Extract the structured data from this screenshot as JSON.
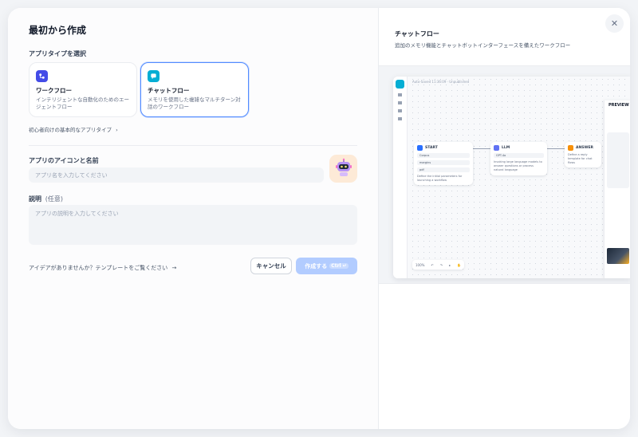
{
  "dialog": {
    "title": "最初から作成"
  },
  "app_type": {
    "label": "アプリタイプを選択",
    "options": [
      {
        "name": "ワークフロー",
        "desc": "インテリジェントな自動化のためのエージェントフロー",
        "selected": false,
        "color": "#444ce7",
        "icon": "workflow-icon"
      },
      {
        "name": "チャットフロー",
        "desc": "メモリを使用した複雑なマルチターン対話のワークフロー",
        "selected": true,
        "color": "#06aed4",
        "icon": "chatflow-icon"
      }
    ],
    "basic_link": "初心者向けの基本的なアプリタイプ"
  },
  "icon_name": {
    "label": "アプリのアイコンと名前",
    "placeholder": "アプリ名を入力してください",
    "avatar_icon": "robot-icon",
    "avatar_bg": "#fdead7"
  },
  "description": {
    "label": "説明",
    "optional": "(任意)",
    "placeholder": "アプリの説明を入力してください"
  },
  "footer": {
    "template_link": "アイデアがありませんか？テンプレートをご覧ください",
    "cancel": "キャンセル",
    "create": "作成する",
    "shortcut": "Ctrl ↵"
  },
  "preview": {
    "title": "チャットフロー",
    "desc": "追加のメモリ機能とチャットボットインターフェースを備えたワークフロー",
    "canvas": {
      "topbar": "Auto-Saved 11:36:09 · Unpublished",
      "preview_label": "PREVIEW",
      "nodes": {
        "start": {
          "title": "START",
          "rows": [
            "Corpus",
            "margins",
            "pdf"
          ],
          "text": "Define the initial parameters for launching a workflow"
        },
        "llm": {
          "title": "LLM",
          "rows": [
            "GPT-4o"
          ],
          "text": "Invoking large language models to answer questions or process natural language"
        },
        "answer": {
          "title": "ANSWER",
          "rows": [],
          "text": "Define a reply template for chat flows"
        }
      },
      "zoom": "100%"
    }
  },
  "colors": {
    "accent": "#155eef",
    "selected_border": "#528bff",
    "create_disabled": "#b2ccff"
  }
}
